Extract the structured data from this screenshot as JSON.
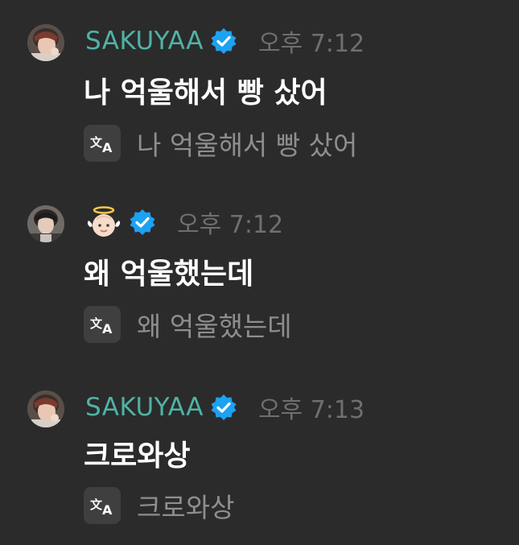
{
  "messages": [
    {
      "author": "SAKUYAA",
      "author_is_emoji": false,
      "verified": true,
      "time": "오후 7:12",
      "text": "나 억울해서 빵 샀어",
      "translation": "나 억울해서 빵 샀어",
      "avatar_icon": "avatar-photo"
    },
    {
      "author": "",
      "author_is_emoji": true,
      "author_emoji": "baby-angel-emoji",
      "verified": true,
      "time": "오후 7:12",
      "text": "왜 억울했는데",
      "translation": "왜 억울했는데",
      "avatar_icon": "avatar-photo"
    },
    {
      "author": "SAKUYAA",
      "author_is_emoji": false,
      "verified": true,
      "time": "오후 7:13",
      "text": "크로와상",
      "translation": "크로와상",
      "avatar_icon": "avatar-photo"
    }
  ],
  "icons": {
    "verified": "verified-badge-icon",
    "translate": "translate-icon"
  },
  "colors": {
    "background": "#2b2b2b",
    "username": "#4fb3a6",
    "verified": "#1da1f2",
    "time": "#6f6f6f",
    "message": "#ffffff",
    "translation": "#8e8e8e"
  }
}
